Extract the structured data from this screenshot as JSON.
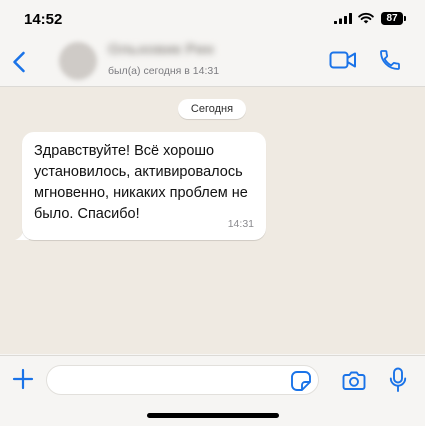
{
  "status_bar": {
    "time": "14:52",
    "battery": "87"
  },
  "header": {
    "contact_name": "Ольховик Рин",
    "last_seen": "был(а) сегодня в 14:31"
  },
  "chat": {
    "date_label": "Сегодня",
    "messages": [
      {
        "text": "Здравствуйте! Всё хорошо установилось, активировалось мгновенно, никаких проблем не было. Спасибо!",
        "time": "14:31",
        "direction": "incoming"
      }
    ]
  },
  "input": {
    "placeholder": ""
  },
  "colors": {
    "accent": "#1a73e8",
    "chat_bg": "#efeae2",
    "bubble_bg": "#ffffff",
    "bar_bg": "#f6f5f3"
  }
}
